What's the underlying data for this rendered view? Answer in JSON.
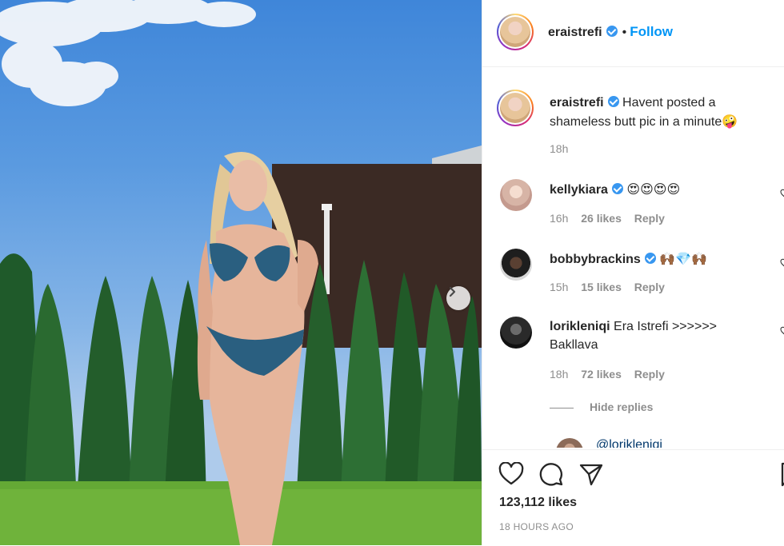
{
  "header": {
    "username": "eraistrefi",
    "dot": "•",
    "follow_label": "Follow"
  },
  "caption": {
    "username": "eraistrefi",
    "text": "Havent posted a shameless butt pic in a minute",
    "emoji": "🤪",
    "time": "18h"
  },
  "comments": [
    {
      "username": "kellykiara",
      "verified": true,
      "text": "😍😍😍😍",
      "time": "16h",
      "likes": "26 likes",
      "reply_label": "Reply"
    },
    {
      "username": "bobbybrackins",
      "verified": true,
      "text": "🙌🏾💎🙌🏾",
      "time": "15h",
      "likes": "15 likes",
      "reply_label": "Reply"
    },
    {
      "username": "lorikleniqi",
      "verified": false,
      "text": "Era Istrefi >>>>>> Bakllava",
      "time": "18h",
      "likes": "72 likes",
      "reply_label": "Reply"
    }
  ],
  "hide_replies_label": "Hide replies",
  "partial_reply": {
    "username": "",
    "mention": "@lorikleniqi"
  },
  "post": {
    "likes_label": "123,112 likes",
    "time_ago": "18 HOURS AGO"
  },
  "icons": {
    "like": "heart-icon",
    "comment": "comment-icon",
    "share": "share-icon",
    "save": "bookmark-icon",
    "next": "chevron-right-icon",
    "verified": "verified-badge-icon"
  },
  "colors": {
    "link": "#0095f6",
    "verified": "#3897f0",
    "muted": "#8e8e8e",
    "text": "#262626"
  }
}
